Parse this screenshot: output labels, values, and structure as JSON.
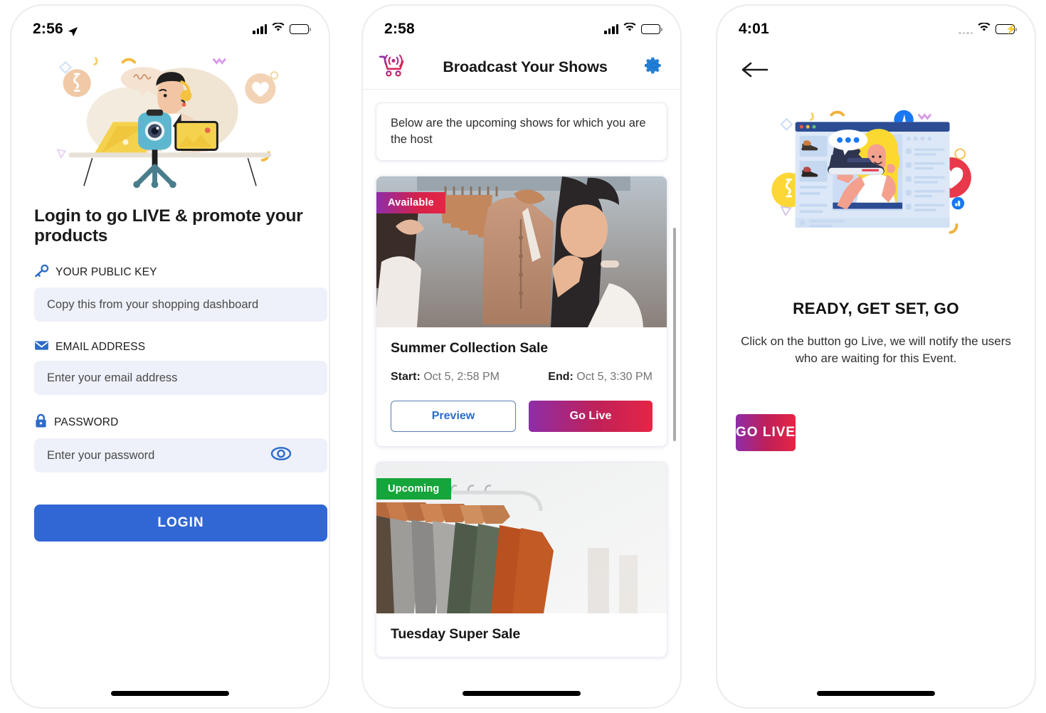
{
  "screens": [
    {
      "id": "login",
      "status_bar": {
        "time": "2:56",
        "location_icon": "location-arrow-icon",
        "signal": "signal-bars-icon",
        "wifi": "wifi-icon",
        "battery": "battery-icon"
      },
      "illustration": "live-streaming-seller-illustration",
      "headline": "Login to go LIVE & promote your products",
      "fields": [
        {
          "icon": "key-icon",
          "label": "YOUR PUBLIC KEY",
          "placeholder": "Copy this from your shopping dashboard",
          "value": ""
        },
        {
          "icon": "envelope-icon",
          "label": "EMAIL ADDRESS",
          "placeholder": "Enter your email address",
          "value": ""
        },
        {
          "icon": "lock-icon",
          "label": "PASSWORD",
          "placeholder": "Enter your password",
          "value": "",
          "trailing_icon": "eye-icon"
        }
      ],
      "login_button": "LOGIN",
      "colors": {
        "primary": "#3167D4",
        "input_bg": "#EEF1F9"
      }
    },
    {
      "id": "broadcast-list",
      "status_bar": {
        "time": "2:58",
        "signal": "signal-bars-icon",
        "wifi": "wifi-icon",
        "battery": "battery-icon"
      },
      "appbar": {
        "logo_icon": "broadcast-cart-icon",
        "title": "Broadcast Your Shows",
        "settings_icon": "gear-icon"
      },
      "notice": "Below are the upcoming shows for which you are the host",
      "cards": [
        {
          "badge": "Available",
          "badge_style": "gradient",
          "image": "woman-browsing-clothing-rack-photo",
          "title": "Summer Collection Sale",
          "start_label": "Start:",
          "start_value": "Oct 5, 2:58 PM",
          "end_label": "End:",
          "end_value": "Oct 5, 3:30 PM",
          "preview_button": "Preview",
          "golive_button": "Go Live"
        },
        {
          "badge": "Upcoming",
          "badge_style": "green",
          "image": "shirts-on-wooden-hangers-photo",
          "title": "Tuesday Super Sale"
        }
      ],
      "colors": {
        "badge_green": "#15A53B",
        "gradient_start": "#8E2DA8",
        "gradient_end": "#E52545",
        "link_blue": "#2C6BC9"
      }
    },
    {
      "id": "go-live",
      "status_bar": {
        "time": "4:01",
        "signal": "signal-dots-icon",
        "wifi": "wifi-icon",
        "battery": "battery-charging-icon"
      },
      "back_icon": "arrow-left-icon",
      "illustration": "live-shopping-browser-illustration",
      "title": "READY, GET SET, GO",
      "subtitle": "Click on the button go Live, we will notify the users who are waiting for this Event.",
      "golive_button": "GO LIVE",
      "colors": {
        "gradient_start": "#8E2DA8",
        "gradient_end": "#E52545",
        "battery_green": "#35C759"
      }
    }
  ]
}
